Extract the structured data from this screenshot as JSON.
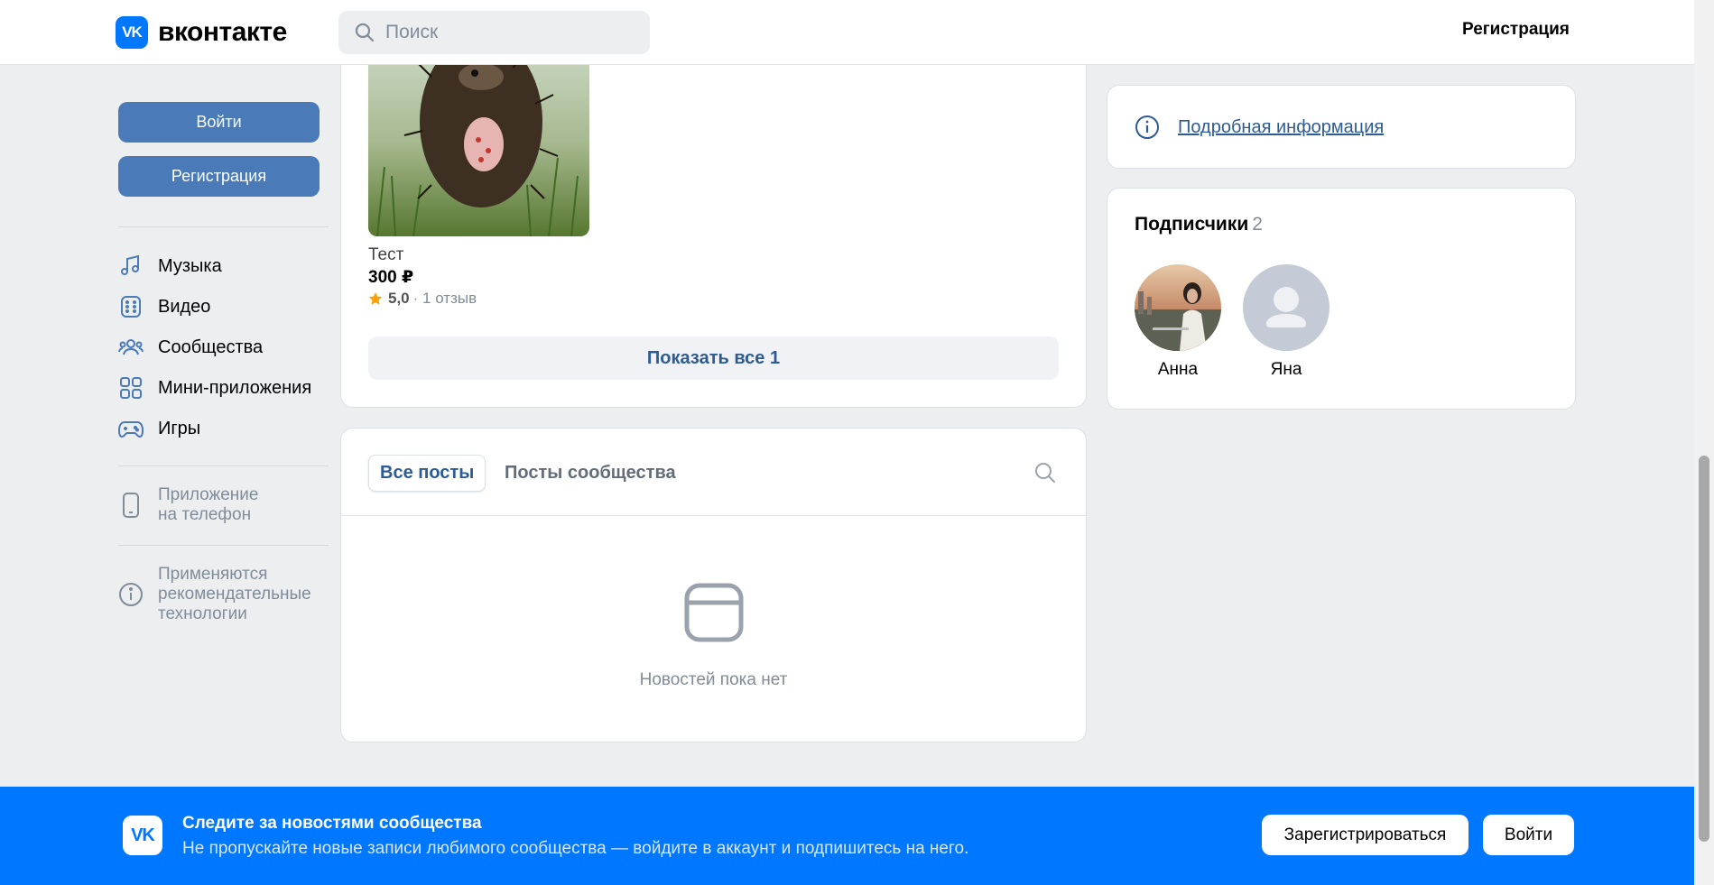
{
  "header": {
    "logo_mark": "VK",
    "logo_text": "вконтакте",
    "search_placeholder": "Поиск",
    "register_label": "Регистрация"
  },
  "sidebar": {
    "login_label": "Войти",
    "register_label": "Регистрация",
    "items": [
      {
        "label": "Музыка",
        "icon": "music-icon"
      },
      {
        "label": "Видео",
        "icon": "video-icon"
      },
      {
        "label": "Сообщества",
        "icon": "communities-icon"
      },
      {
        "label": "Мини-приложения",
        "icon": "mini-apps-icon"
      },
      {
        "label": "Игры",
        "icon": "games-icon"
      }
    ],
    "phone_app_line1": "Приложение",
    "phone_app_line2": "на телефон",
    "rec_tech_line1": "Применяются",
    "rec_tech_line2": "рекомендательные",
    "rec_tech_line3": "технологии"
  },
  "product": {
    "name": "Тест",
    "price": "300 ₽",
    "rating": "5,0",
    "reviews": "· 1 отзыв",
    "show_all_label": "Показать все 1"
  },
  "posts": {
    "tab_all": "Все посты",
    "tab_community": "Посты сообщества",
    "empty_text": "Новостей пока нет"
  },
  "info": {
    "link_label": "Подробная информация"
  },
  "subscribers": {
    "title": "Подписчики",
    "count": "2",
    "people": [
      {
        "name": "Анна"
      },
      {
        "name": "Яна"
      }
    ]
  },
  "bottom_bar": {
    "logo_mark": "VK",
    "title": "Следите за новостями сообщества",
    "subtitle": "Не пропускайте новые записи любимого сообщества — войдите в аккаунт и подпишитесь на него.",
    "register_label": "Зарегистрироваться",
    "login_label": "Войти"
  },
  "colors": {
    "accent": "#0077ff",
    "button_blue": "#4a7ab7",
    "link": "#2d5b93",
    "background": "#edeef0",
    "star": "#ffa000"
  }
}
